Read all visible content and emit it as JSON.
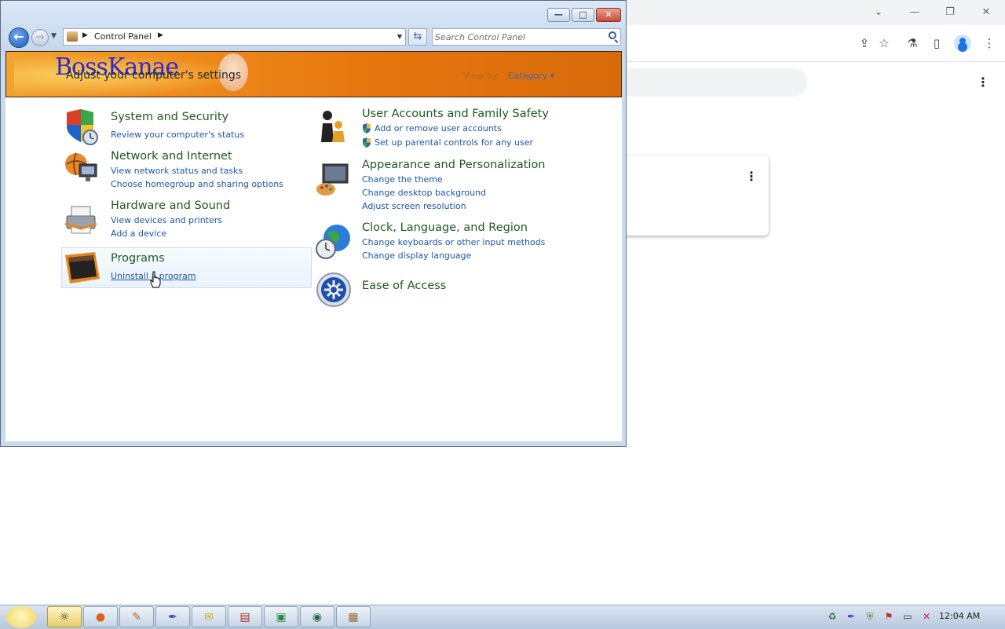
{
  "chrome": {
    "window_controls": [
      "⌄",
      "—",
      "❐",
      "✕"
    ],
    "toolbar_icons": [
      "share-icon",
      "star-icon",
      "labs-icon",
      "side-panel-icon",
      "profile-icon",
      "menu-icon"
    ]
  },
  "control_panel": {
    "window_controls": {
      "minimize": "—",
      "maximize": "□",
      "close": "✕"
    },
    "address": {
      "path": "Control Panel"
    },
    "search": {
      "placeholder": "Search Control Panel"
    },
    "banner": {
      "logo": "BossKanae",
      "title": "Adjust your computer's settings",
      "view_by_label": "View by:",
      "view_by_value": "Category ▾"
    },
    "categories": [
      {
        "title": "System and Security",
        "links": [
          "Review your computer's status"
        ]
      },
      {
        "title": "Network and Internet",
        "links": [
          "View network status and tasks",
          "Choose homegroup and sharing options"
        ]
      },
      {
        "title": "Hardware and Sound",
        "links": [
          "View devices and printers",
          "Add a device"
        ]
      },
      {
        "title": "Programs",
        "links": [
          "Uninstall a program"
        ]
      },
      {
        "title": "User Accounts and Family Safety",
        "links": [
          "Add or remove user accounts",
          "Set up parental controls for any user"
        ]
      },
      {
        "title": "Appearance and Personalization",
        "links": [
          "Change the theme",
          "Change desktop background",
          "Adjust screen resolution"
        ]
      },
      {
        "title": "Clock, Language, and Region",
        "links": [
          "Change keyboards or other input methods",
          "Change display language"
        ]
      },
      {
        "title": "Ease of Access",
        "links": []
      }
    ]
  },
  "taskbar": {
    "clock": "12:04 AM",
    "colors": {
      "accent": "#1c56a6",
      "category_title": "#1e5a1e",
      "banner": "#ee8a1b"
    }
  }
}
